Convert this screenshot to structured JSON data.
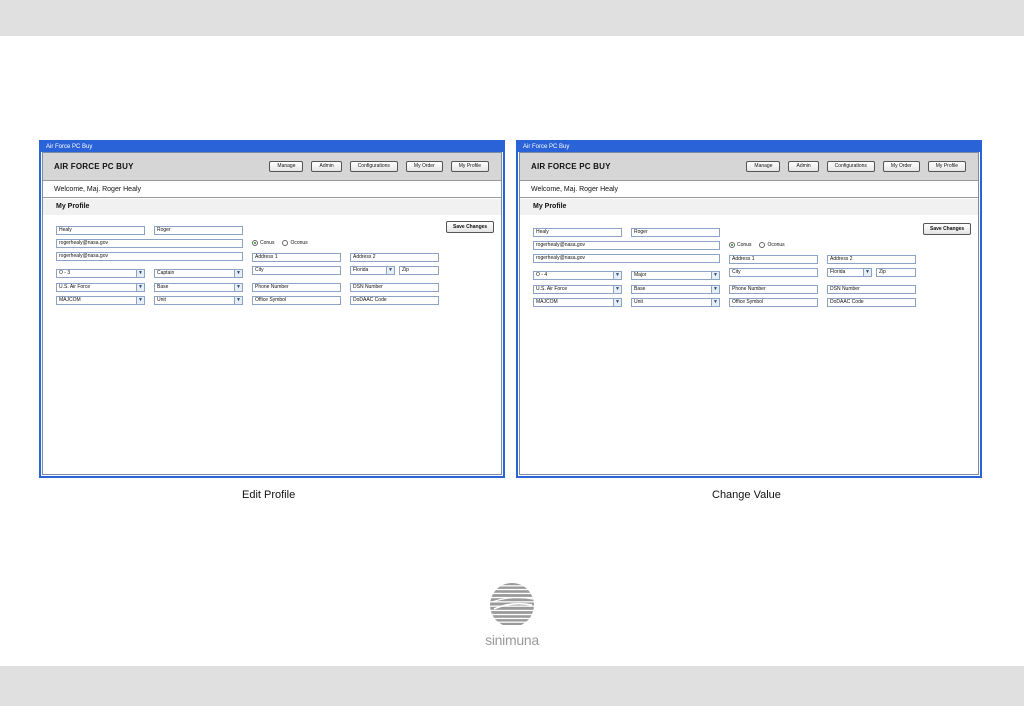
{
  "left_window": {
    "titlebar": "Air Force PC Buy",
    "app_title": "AIR FORCE PC BUY",
    "nav": [
      "Manage",
      "Admin",
      "Configurations",
      "My Order",
      "My Profile"
    ],
    "welcome": "Welcome, Maj. Roger Healy",
    "section_title": "My Profile",
    "save_label": "Save Changes",
    "last_name": "Healy",
    "first_name": "Roger",
    "email": "rogerhealy@nasa.gov",
    "email_confirm": "rogerhealy@nasa.gov",
    "radio_conus": "Conus",
    "radio_oconus": "Oconus",
    "address1": "Address 1",
    "address2": "Address 2",
    "grade": "O - 3",
    "rank": "Captain",
    "city": "City",
    "state": "Florida",
    "zip": "Zip",
    "branch": "U.S. Air Force",
    "base": "Base",
    "phone": "Phone Number",
    "dsn": "DSN Number",
    "majcom": "MAJCOM",
    "unit": "Unit",
    "office_symbol": "Office Symbol",
    "dodaac": "DoDAAC Code",
    "dropdown_arrow": "▼"
  },
  "right_window": {
    "titlebar": "Air Force PC Buy",
    "app_title": "AIR FORCE PC BUY",
    "nav": [
      "Manage",
      "Admin",
      "Configurations",
      "My Order",
      "My Profile"
    ],
    "welcome": "Welcome, Maj. Roger Healy",
    "section_title": "My Profile",
    "save_label": "Save Changes",
    "last_name": "Healy",
    "first_name": "Roger",
    "email": "rogerhealy@nasa.gov",
    "email_confirm": "rogerhealy@nasa.gov",
    "radio_conus": "Conus",
    "radio_oconus": "Oconus",
    "address1": "Address 1",
    "address2": "Address 2",
    "grade": "O - 4",
    "rank": "Major",
    "city": "City",
    "state": "Florida",
    "zip": "Zip",
    "branch": "U.S. Air Force",
    "base": "Base",
    "phone": "Phone Number",
    "dsn": "DSN Number",
    "majcom": "MAJCOM",
    "unit": "Unit",
    "office_symbol": "Office Symbol",
    "dodaac": "DoDAAC Code",
    "dropdown_arrow": "▼"
  },
  "captions": {
    "left": "Edit Profile",
    "right": "Change Value"
  },
  "logo": {
    "text": "sinimuna",
    "icon": "striped-globe-icon",
    "color": "#9a9a9a"
  },
  "colors": {
    "window_border": "#2a63d8",
    "field_border": "#8ba3c4",
    "band": "#e0e0e0"
  }
}
